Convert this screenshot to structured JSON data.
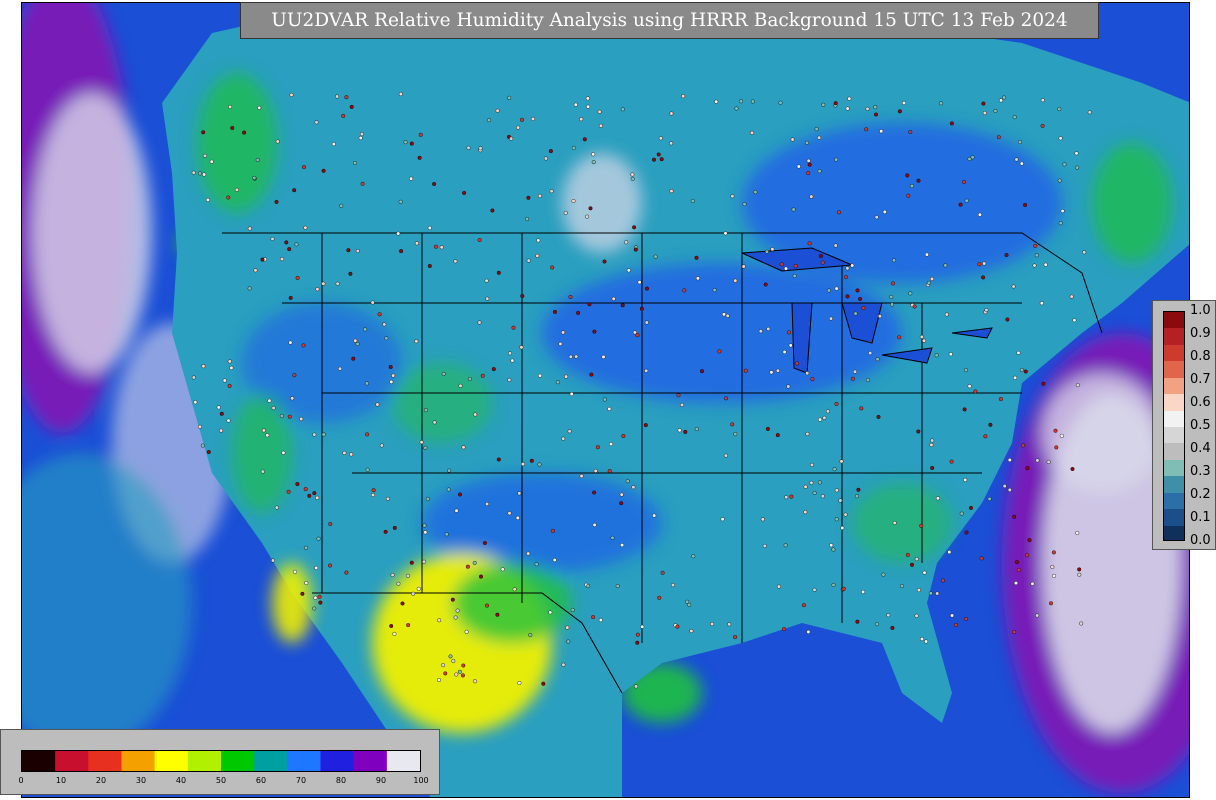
{
  "title": "UU2DVAR Relative Humidity Analysis using HRRR Background 15 UTC 13 Feb 2024",
  "rh_colorbar": {
    "ticks": [
      "0",
      "10",
      "20",
      "30",
      "40",
      "50",
      "60",
      "70",
      "80",
      "90",
      "100"
    ],
    "colors": [
      "#1a0000",
      "#c8102e",
      "#e83020",
      "#f4a000",
      "#ffff00",
      "#b0f000",
      "#00c800",
      "#00a0a0",
      "#1e78ff",
      "#2020e0",
      "#8000c0",
      "#e8e8f0"
    ]
  },
  "obs_colorbar": {
    "ticks": [
      "1.0",
      "0.9",
      "0.8",
      "0.7",
      "0.6",
      "0.5",
      "0.4",
      "0.3",
      "0.2",
      "0.1",
      "0.0"
    ],
    "colors": [
      "#8b0a0e",
      "#b42024",
      "#cf3a2e",
      "#e0654a",
      "#f2a283",
      "#f9d6c5",
      "#f2f2f2",
      "#d6d6d6",
      "#bdbdbd",
      "#7fbdb5",
      "#3f8fa8",
      "#2c6fa8",
      "#1c4f8a",
      "#10305c"
    ]
  },
  "map": {
    "colors": {
      "ocean": "#1a4fd6",
      "land_humid": "#2060e8",
      "land_mid": "#2a9fbf",
      "dry_green": "#20c040",
      "dry_yellow": "#f0f000",
      "saturated": "#d8d8e8",
      "violet": "#9010b0",
      "border": "#000000"
    }
  }
}
